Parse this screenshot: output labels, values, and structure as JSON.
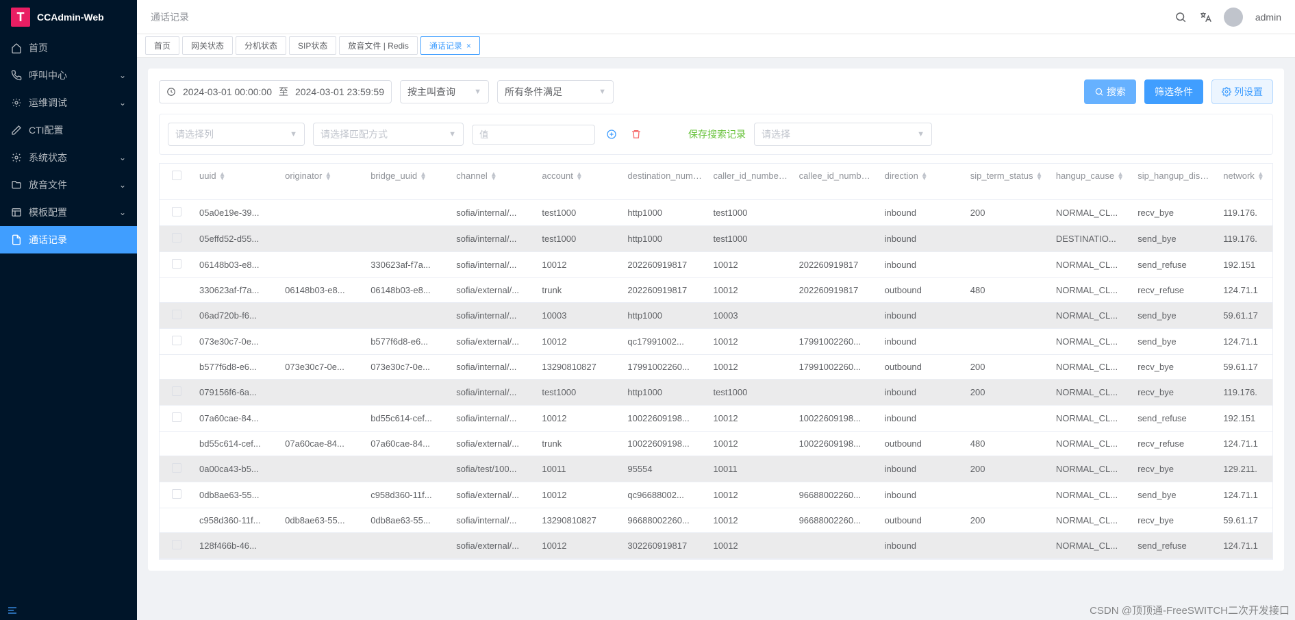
{
  "app": {
    "logo_letter": "T",
    "name": "CCAdmin-Web"
  },
  "breadcrumb": "通话记录",
  "topbar": {
    "username": "admin"
  },
  "sidebar": {
    "items": [
      {
        "icon": "home",
        "label": "首页",
        "expandable": false
      },
      {
        "icon": "phone",
        "label": "呼叫中心",
        "expandable": true
      },
      {
        "icon": "tools",
        "label": "运维调试",
        "expandable": true
      },
      {
        "icon": "edit",
        "label": "CTI配置",
        "expandable": false
      },
      {
        "icon": "gear",
        "label": "系统状态",
        "expandable": true
      },
      {
        "icon": "folder",
        "label": "放音文件",
        "expandable": true
      },
      {
        "icon": "template",
        "label": "模板配置",
        "expandable": true
      },
      {
        "icon": "doc",
        "label": "通话记录",
        "expandable": false,
        "active": true
      }
    ]
  },
  "tabs": [
    {
      "label": "首页"
    },
    {
      "label": "网关状态"
    },
    {
      "label": "分机状态"
    },
    {
      "label": "SIP状态"
    },
    {
      "label": "放音文件 | Redis"
    },
    {
      "label": "通话记录",
      "active": true,
      "closable": true
    }
  ],
  "filters": {
    "date_from": "2024-03-01 00:00:00",
    "date_sep": "至",
    "date_to": "2024-03-01 23:59:59",
    "group_by_label": "按主叫查询",
    "condition_label": "所有条件满足",
    "search_btn": "搜索",
    "filter_btn": "筛选条件",
    "columns_btn": "列设置",
    "col_placeholder": "请选择列",
    "match_placeholder": "请选择匹配方式",
    "value_placeholder": "值",
    "save_label": "保存搜索记录",
    "saved_placeholder": "请选择"
  },
  "table": {
    "headers": [
      "uuid",
      "originator",
      "bridge_uuid",
      "channel",
      "account",
      "destination_number",
      "caller_id_number",
      "callee_id_number",
      "direction",
      "sip_term_status",
      "hangup_cause",
      "sip_hangup_disposition",
      "network"
    ],
    "groups": [
      {
        "rows": [
          {
            "uuid": "05a0e19e-39...",
            "originator": "",
            "bridge_uuid": "",
            "channel": "sofia/internal/...",
            "account": "test1000",
            "destination_number": "http1000",
            "caller_id_number": "test1000",
            "callee_id_number": "",
            "direction": "inbound",
            "sip_term_status": "200",
            "hangup_cause": "NORMAL_CL...",
            "sip_hangup_disposition": "recv_bye",
            "network": "119.176."
          }
        ]
      },
      {
        "striped": true,
        "rows": [
          {
            "uuid": "05effd52-d55...",
            "originator": "",
            "bridge_uuid": "",
            "channel": "sofia/internal/...",
            "account": "test1000",
            "destination_number": "http1000",
            "caller_id_number": "test1000",
            "callee_id_number": "",
            "direction": "inbound",
            "sip_term_status": "",
            "hangup_cause": "DESTINATIO...",
            "sip_hangup_disposition": "send_bye",
            "network": "119.176."
          }
        ]
      },
      {
        "rows": [
          {
            "uuid": "06148b03-e8...",
            "originator": "",
            "bridge_uuid": "330623af-f7a...",
            "channel": "sofia/internal/...",
            "account": "10012",
            "destination_number": "202260919817",
            "caller_id_number": "10012",
            "callee_id_number": "202260919817",
            "direction": "inbound",
            "sip_term_status": "",
            "hangup_cause": "NORMAL_CL...",
            "sip_hangup_disposition": "send_refuse",
            "network": "192.151"
          },
          {
            "uuid": "330623af-f7a...",
            "originator": "06148b03-e8...",
            "bridge_uuid": "06148b03-e8...",
            "channel": "sofia/external/...",
            "account": "trunk",
            "destination_number": "202260919817",
            "caller_id_number": "10012",
            "callee_id_number": "202260919817",
            "direction": "outbound",
            "sip_term_status": "480",
            "hangup_cause": "NORMAL_CL...",
            "sip_hangup_disposition": "recv_refuse",
            "network": "124.71.1"
          }
        ]
      },
      {
        "striped": true,
        "rows": [
          {
            "uuid": "06ad720b-f6...",
            "originator": "",
            "bridge_uuid": "",
            "channel": "sofia/internal/...",
            "account": "10003",
            "destination_number": "http1000",
            "caller_id_number": "10003",
            "callee_id_number": "",
            "direction": "inbound",
            "sip_term_status": "",
            "hangup_cause": "NORMAL_CL...",
            "sip_hangup_disposition": "send_bye",
            "network": "59.61.17"
          }
        ]
      },
      {
        "rows": [
          {
            "uuid": "073e30c7-0e...",
            "originator": "",
            "bridge_uuid": "b577f6d8-e6...",
            "channel": "sofia/external/...",
            "account": "10012",
            "destination_number": "qc17991002...",
            "caller_id_number": "10012",
            "callee_id_number": "17991002260...",
            "direction": "inbound",
            "sip_term_status": "",
            "hangup_cause": "NORMAL_CL...",
            "sip_hangup_disposition": "send_bye",
            "network": "124.71.1"
          },
          {
            "uuid": "b577f6d8-e6...",
            "originator": "073e30c7-0e...",
            "bridge_uuid": "073e30c7-0e...",
            "channel": "sofia/internal/...",
            "account": "13290810827",
            "destination_number": "17991002260...",
            "caller_id_number": "10012",
            "callee_id_number": "17991002260...",
            "direction": "outbound",
            "sip_term_status": "200",
            "hangup_cause": "NORMAL_CL...",
            "sip_hangup_disposition": "recv_bye",
            "network": "59.61.17"
          }
        ]
      },
      {
        "striped": true,
        "rows": [
          {
            "uuid": "079156f6-6a...",
            "originator": "",
            "bridge_uuid": "",
            "channel": "sofia/internal/...",
            "account": "test1000",
            "destination_number": "http1000",
            "caller_id_number": "test1000",
            "callee_id_number": "",
            "direction": "inbound",
            "sip_term_status": "200",
            "hangup_cause": "NORMAL_CL...",
            "sip_hangup_disposition": "recv_bye",
            "network": "119.176."
          }
        ]
      },
      {
        "rows": [
          {
            "uuid": "07a60cae-84...",
            "originator": "",
            "bridge_uuid": "bd55c614-cef...",
            "channel": "sofia/internal/...",
            "account": "10012",
            "destination_number": "10022609198...",
            "caller_id_number": "10012",
            "callee_id_number": "10022609198...",
            "direction": "inbound",
            "sip_term_status": "",
            "hangup_cause": "NORMAL_CL...",
            "sip_hangup_disposition": "send_refuse",
            "network": "192.151"
          },
          {
            "uuid": "bd55c614-cef...",
            "originator": "07a60cae-84...",
            "bridge_uuid": "07a60cae-84...",
            "channel": "sofia/external/...",
            "account": "trunk",
            "destination_number": "10022609198...",
            "caller_id_number": "10012",
            "callee_id_number": "10022609198...",
            "direction": "outbound",
            "sip_term_status": "480",
            "hangup_cause": "NORMAL_CL...",
            "sip_hangup_disposition": "recv_refuse",
            "network": "124.71.1"
          }
        ]
      },
      {
        "striped": true,
        "rows": [
          {
            "uuid": "0a00ca43-b5...",
            "originator": "",
            "bridge_uuid": "",
            "channel": "sofia/test/100...",
            "account": "10011",
            "destination_number": "95554",
            "caller_id_number": "10011",
            "callee_id_number": "",
            "direction": "inbound",
            "sip_term_status": "200",
            "hangup_cause": "NORMAL_CL...",
            "sip_hangup_disposition": "recv_bye",
            "network": "129.211."
          }
        ]
      },
      {
        "rows": [
          {
            "uuid": "0db8ae63-55...",
            "originator": "",
            "bridge_uuid": "c958d360-11f...",
            "channel": "sofia/external/...",
            "account": "10012",
            "destination_number": "qc96688002...",
            "caller_id_number": "10012",
            "callee_id_number": "96688002260...",
            "direction": "inbound",
            "sip_term_status": "",
            "hangup_cause": "NORMAL_CL...",
            "sip_hangup_disposition": "send_bye",
            "network": "124.71.1"
          },
          {
            "uuid": "c958d360-11f...",
            "originator": "0db8ae63-55...",
            "bridge_uuid": "0db8ae63-55...",
            "channel": "sofia/internal/...",
            "account": "13290810827",
            "destination_number": "96688002260...",
            "caller_id_number": "10012",
            "callee_id_number": "96688002260...",
            "direction": "outbound",
            "sip_term_status": "200",
            "hangup_cause": "NORMAL_CL...",
            "sip_hangup_disposition": "recv_bye",
            "network": "59.61.17"
          }
        ]
      },
      {
        "striped": true,
        "rows": [
          {
            "uuid": "128f466b-46...",
            "originator": "",
            "bridge_uuid": "",
            "channel": "sofia/external/...",
            "account": "10012",
            "destination_number": "302260919817",
            "caller_id_number": "10012",
            "callee_id_number": "",
            "direction": "inbound",
            "sip_term_status": "",
            "hangup_cause": "NORMAL_CL...",
            "sip_hangup_disposition": "send_refuse",
            "network": "124.71.1"
          }
        ]
      }
    ]
  },
  "watermark": "CSDN @顶顶通-FreeSWITCH二次开发接口"
}
